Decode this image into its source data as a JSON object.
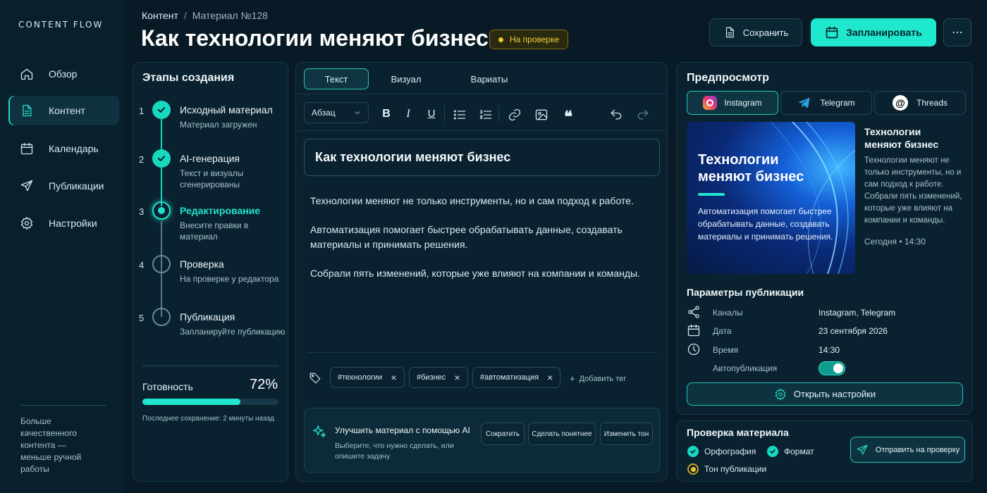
{
  "brand": "CONTENT FLOW",
  "nav": [
    {
      "label": "Обзор",
      "icon": "home-icon"
    },
    {
      "label": "Контент",
      "icon": "document-icon",
      "active": true
    },
    {
      "label": "Календарь",
      "icon": "calendar-icon"
    },
    {
      "label": "Публикации",
      "icon": "send-icon"
    },
    {
      "label": "Настройки",
      "icon": "gear-icon"
    }
  ],
  "side_note": "Больше качественного контента — меньше ручной работы",
  "breadcrumb": {
    "root": "Контент",
    "sep": "/",
    "current": "Материал №128"
  },
  "title": "Как технологии меняют бизнес",
  "status_badge": "На проверке",
  "actions": {
    "save": "Сохранить",
    "schedule": "Запланировать",
    "more": "⋯"
  },
  "stages": {
    "title": "Этапы создания",
    "items": [
      {
        "num": "1",
        "title": "Исходный материал",
        "desc": "Материал загружен",
        "state": "done"
      },
      {
        "num": "2",
        "title": "AI-генерация",
        "desc": "Текст и визуалы сгенерированы",
        "state": "done"
      },
      {
        "num": "3",
        "title": "Редактирование",
        "desc": "Внесите правки в материал",
        "state": "current"
      },
      {
        "num": "4",
        "title": "Проверка",
        "desc": "На проверке у редактора",
        "state": "pending"
      },
      {
        "num": "5",
        "title": "Публикация",
        "desc": "Запланируйте публикацию",
        "state": "pending"
      }
    ],
    "readiness_label": "Готовность",
    "readiness_value": "72%",
    "readiness_fraction": 0.72,
    "last_save": "Последнее сохранение: 2 минуты назад"
  },
  "editor": {
    "tabs": [
      "Текст",
      "Визуал",
      "Вариаты"
    ],
    "paragraph_select": "Абзац",
    "heading": "Как технологии меняют бизнес",
    "paragraphs": [
      "Технологии меняют не только инструменты, но и сам подход к работе.",
      "Автоматизация помогает быстрее обрабатывать данные, создавать материалы и принимать решения.",
      "Собрали пять изменений, которые уже влияют на компании и команды."
    ],
    "tags": [
      "#технологии",
      "#бизнес",
      "#автоматизация"
    ],
    "add_tag": "Добавить тег",
    "ai": {
      "title": "Улучшить материал с помощью AI",
      "desc": "Выберите, что нужно сделать, или опишите задачу",
      "buttons": [
        "Сократить",
        "Сделать понятнее",
        "Изменить тон"
      ]
    }
  },
  "preview": {
    "title": "Предпросмотр",
    "channels": [
      "Instagram",
      "Telegram",
      "Threads"
    ],
    "card_title": "Технологии меняют бизнес",
    "card_text": "Автоматизация помогает быстрее обрабатывать данные, создавать материалы и принимать решения.",
    "post_title": "Технологии меняют бизнес",
    "post_text": "Технологии меняют не только инструменты, но и сам подход к работе. Собрали пять изменений, которые уже влияют на компании и команды.",
    "post_meta": "Сегодня • 14:30"
  },
  "params": {
    "title": "Параметры публикации",
    "rows": [
      {
        "key": "Каналы",
        "value": "Instagram, Telegram"
      },
      {
        "key": "Дата",
        "value": "23 сентября 2026"
      },
      {
        "key": "Время",
        "value": "14:30"
      },
      {
        "key": "Автопубликация",
        "value": ""
      }
    ],
    "autopublish": true,
    "open_settings": "Открыть настройки"
  },
  "check": {
    "title": "Проверка материала",
    "items": [
      "Орфография",
      "Формат",
      "Тон публикации"
    ],
    "send": "Отправить на проверку"
  },
  "colors": {
    "accent": "#1fe8cf",
    "warning": "#f2c230",
    "bg": "#071a25"
  }
}
